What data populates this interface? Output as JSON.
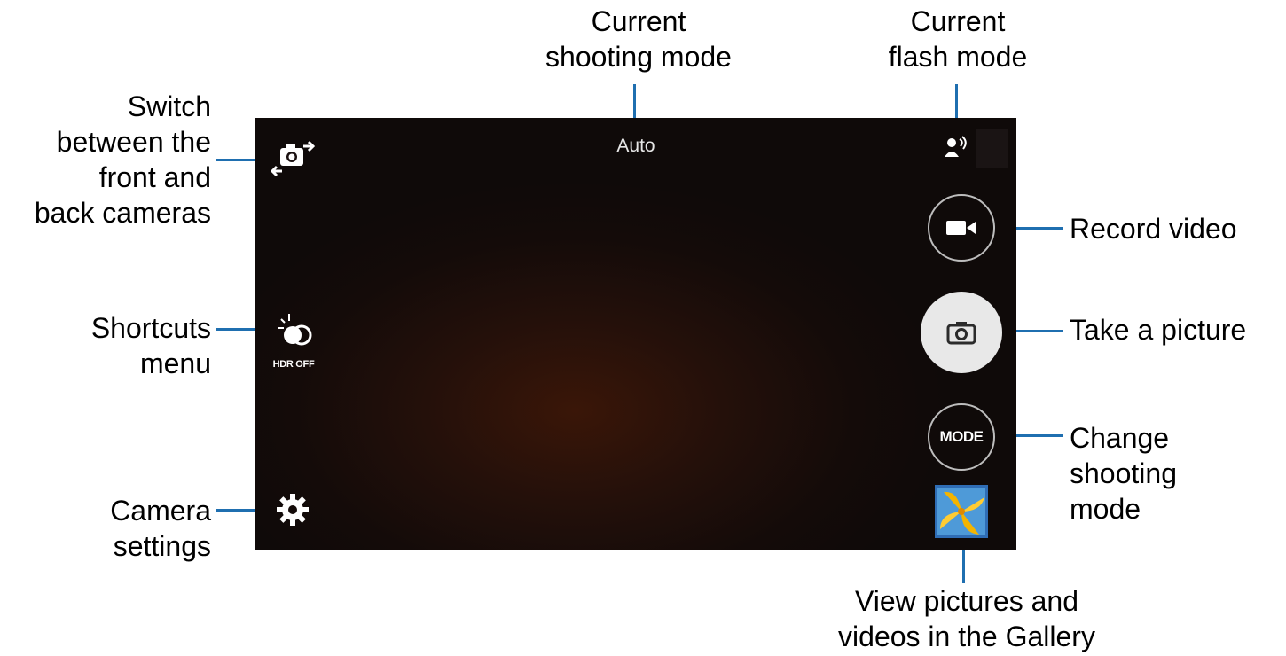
{
  "screen": {
    "shooting_mode": "Auto",
    "hdr_label": "HDR OFF",
    "mode_button_label": "MODE"
  },
  "callouts": {
    "current_shooting_mode": [
      "Current",
      "shooting mode"
    ],
    "current_flash_mode": [
      "Current",
      "flash mode"
    ],
    "switch_cameras": [
      "Switch",
      "between the",
      "front and",
      "back cameras"
    ],
    "shortcuts_menu": [
      "Shortcuts",
      "menu"
    ],
    "camera_settings": [
      "Camera",
      "settings"
    ],
    "record_video": [
      "Record video"
    ],
    "take_picture": [
      "Take a picture"
    ],
    "change_mode": [
      "Change",
      "shooting",
      "mode"
    ],
    "view_gallery": [
      "View pictures and",
      "videos in the Gallery"
    ]
  },
  "icons": {
    "switch_camera": "switch-camera-icon",
    "hdr": "hdr-icon",
    "settings": "gear-icon",
    "flash": "flash-mode-icon",
    "record": "video-camera-icon",
    "capture": "camera-icon",
    "gallery": "gallery-thumbnail-icon"
  },
  "colors": {
    "leader_line": "#1f6fb0",
    "screen_bg": "#140b09"
  }
}
